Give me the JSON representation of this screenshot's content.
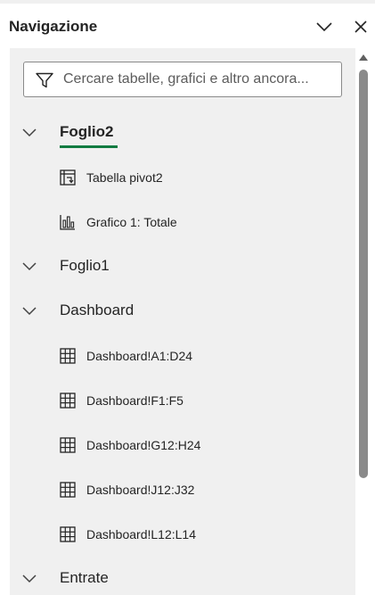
{
  "pane": {
    "title": "Navigazione",
    "collapse_icon": "chevron-down-icon",
    "close_icon": "close-icon"
  },
  "search": {
    "placeholder": "Cercare tabelle, grafici e altro ancora...",
    "value": "",
    "icon": "filter-icon"
  },
  "tree": {
    "groups": [
      {
        "label": "Foglio2",
        "active": true,
        "items": [
          {
            "label": "Tabella pivot2",
            "icon": "pivot-table-icon"
          },
          {
            "label": "Grafico 1: Totale",
            "icon": "bar-chart-icon"
          }
        ]
      },
      {
        "label": "Foglio1",
        "active": false,
        "items": []
      },
      {
        "label": "Dashboard",
        "active": false,
        "items": [
          {
            "label": "Dashboard!A1:D24",
            "icon": "range-grid-icon"
          },
          {
            "label": "Dashboard!F1:F5",
            "icon": "range-grid-icon"
          },
          {
            "label": "Dashboard!G12:H24",
            "icon": "range-grid-icon"
          },
          {
            "label": "Dashboard!J12:J32",
            "icon": "range-grid-icon"
          },
          {
            "label": "Dashboard!L12:L14",
            "icon": "range-grid-icon"
          }
        ]
      },
      {
        "label": "Entrate",
        "active": false,
        "items": []
      }
    ]
  },
  "colors": {
    "accent": "#107c41",
    "panel_bg": "#f0f0f0",
    "text": "#242424"
  }
}
